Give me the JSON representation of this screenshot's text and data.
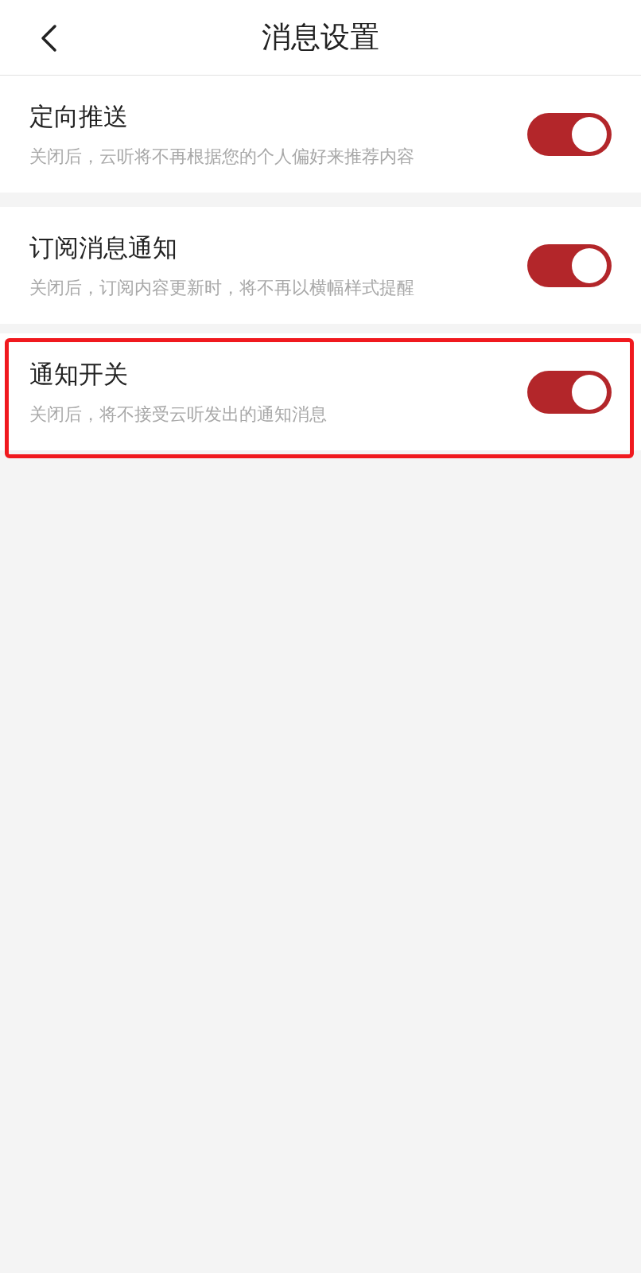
{
  "header": {
    "title": "消息设置"
  },
  "settings": [
    {
      "title": "定向推送",
      "description": "关闭后，云听将不再根据您的个人偏好来推荐内容",
      "on": true,
      "highlighted": false
    },
    {
      "title": "订阅消息通知",
      "description": "关闭后，订阅内容更新时，将不再以横幅样式提醒",
      "on": true,
      "highlighted": false
    },
    {
      "title": "通知开关",
      "description": "关闭后，将不接受云听发出的通知消息",
      "on": true,
      "highlighted": true
    }
  ]
}
